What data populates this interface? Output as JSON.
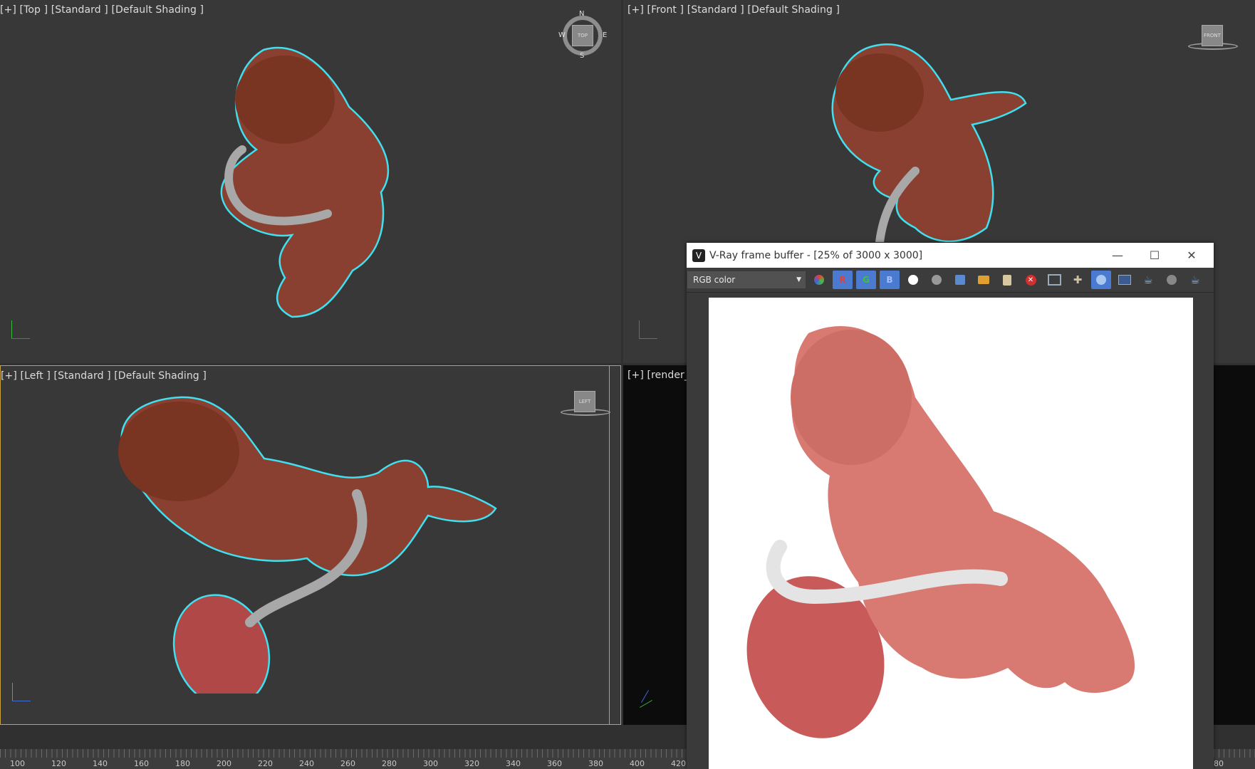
{
  "viewports": {
    "top": {
      "plus": "[+]",
      "view": "[Top ]",
      "shading": "[Standard ]",
      "mode": "[Default Shading ]",
      "cube": "TOP",
      "compass": {
        "n": "N",
        "s": "S",
        "w": "W",
        "e": "E"
      }
    },
    "front": {
      "plus": "[+]",
      "view": "[Front ]",
      "shading": "[Standard ]",
      "mode": "[Default Shading ]",
      "cube": "FRONT"
    },
    "left": {
      "plus": "[+]",
      "view": "[Left ]",
      "shading": "[Standard ]",
      "mode": "[Default Shading ]",
      "cube": "LEFT"
    },
    "camera": {
      "plus": "[+]",
      "view": "[render_ca"
    }
  },
  "vray": {
    "title": "V-Ray frame buffer - [25% of 3000 x 3000]",
    "channel": "RGB color",
    "toolbar": [
      "R",
      "G",
      "B"
    ]
  },
  "timeline": {
    "ticks": [
      "100",
      "120",
      "140",
      "160",
      "180",
      "200",
      "220",
      "240",
      "260",
      "280",
      "300",
      "320",
      "340",
      "360",
      "380",
      "400",
      "420"
    ],
    "right_tick": "80"
  },
  "colors": {
    "selection": "#40e0f0",
    "active_border": "#c8a040",
    "vray_blue": "#4b7bd0"
  }
}
